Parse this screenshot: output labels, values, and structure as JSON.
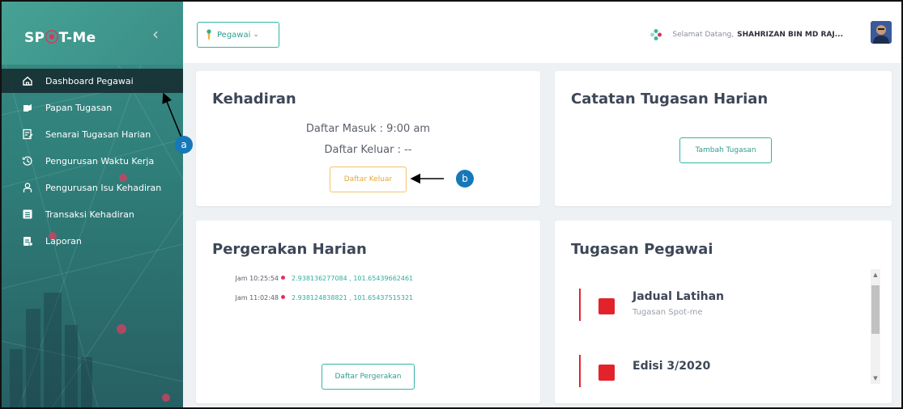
{
  "sidebar": {
    "logo_left": "SP",
    "logo_pin": "⦿",
    "logo_right": "T-Me",
    "collapse_glyph": "‹",
    "items": [
      {
        "label": "Dashboard Pegawai",
        "icon": "home-icon",
        "active": true
      },
      {
        "label": "Papan Tugasan",
        "icon": "clipboard-hand-icon"
      },
      {
        "label": "Senarai Tugasan Harian",
        "icon": "edit-list-icon"
      },
      {
        "label": "Pengurusan Waktu Kerja",
        "icon": "clock-history-icon"
      },
      {
        "label": "Pengurusan Isu Kehadiran",
        "icon": "user-outline-icon"
      },
      {
        "label": "Transaksi Kehadiran",
        "icon": "list-box-icon"
      },
      {
        "label": "Laporan",
        "icon": "report-icon"
      }
    ]
  },
  "topbar": {
    "dropdown_label": "Pegawai",
    "welcome_label": "Selamat Datang,",
    "user_name": "SHAHRIZAN BIN MD RAJ..."
  },
  "kehadiran": {
    "title": "Kehadiran",
    "daftar_masuk": "Daftar Masuk : 9:00 am",
    "daftar_keluar": "Daftar Keluar : --",
    "button": "Daftar Keluar"
  },
  "catatan": {
    "title": "Catatan Tugasan Harian",
    "button": "Tambah Tugasan"
  },
  "pergerakan": {
    "title": "Pergerakan Harian",
    "logs": [
      {
        "time": "Jam 10:25:54",
        "coord": "2.938136277084 , 101.65439662461"
      },
      {
        "time": "Jam 11:02:48",
        "coord": "2.938124838821 , 101.65437515321"
      }
    ],
    "button": "Daftar Pergerakan"
  },
  "tugasan": {
    "title": "Tugasan Pegawai",
    "items": [
      {
        "title": "Jadual Latihan",
        "subtitle": "Tugasan Spot-me"
      },
      {
        "title": "Edisi 3/2020",
        "subtitle": ""
      }
    ]
  },
  "annotations": {
    "a": "a",
    "b": "b"
  },
  "colors": {
    "accent": "#35b5a4",
    "warning": "#f2c46c",
    "danger": "#e3232c",
    "callout": "#1678b8"
  }
}
